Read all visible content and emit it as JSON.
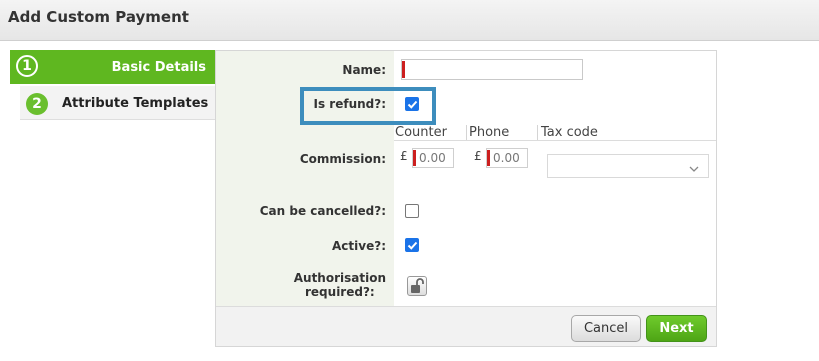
{
  "window": {
    "title": "Add Custom Payment"
  },
  "steps": [
    {
      "number": "1",
      "label": "Basic Details",
      "active": true
    },
    {
      "number": "2",
      "label": "Attribute Templates",
      "active": false
    }
  ],
  "form": {
    "name_label": "Name:",
    "name_value": "",
    "refund_label": "Is refund?:",
    "refund_checked": true,
    "commission_headers": {
      "counter": "Counter",
      "phone": "Phone",
      "tax_code": "Tax code"
    },
    "commission_label": "Commission:",
    "currency_symbol": "£",
    "counter_value": "0.00",
    "phone_value": "0.00",
    "tax_code_value": "",
    "cancellable_label": "Can be cancelled?:",
    "cancellable_checked": false,
    "active_label": "Active?:",
    "active_checked": true,
    "authorisation_label_line1": "Authorisation",
    "authorisation_label_line2": "required?:",
    "authorisation_icon": "unlocked-padlock-icon"
  },
  "buttons": {
    "cancel": "Cancel",
    "next": "Next"
  },
  "colors": {
    "accent_green": "#5fb720",
    "highlight_blue": "#3d8dbd",
    "required_marker": "#cc1f1f",
    "checkbox_blue": "#1a73e8"
  }
}
